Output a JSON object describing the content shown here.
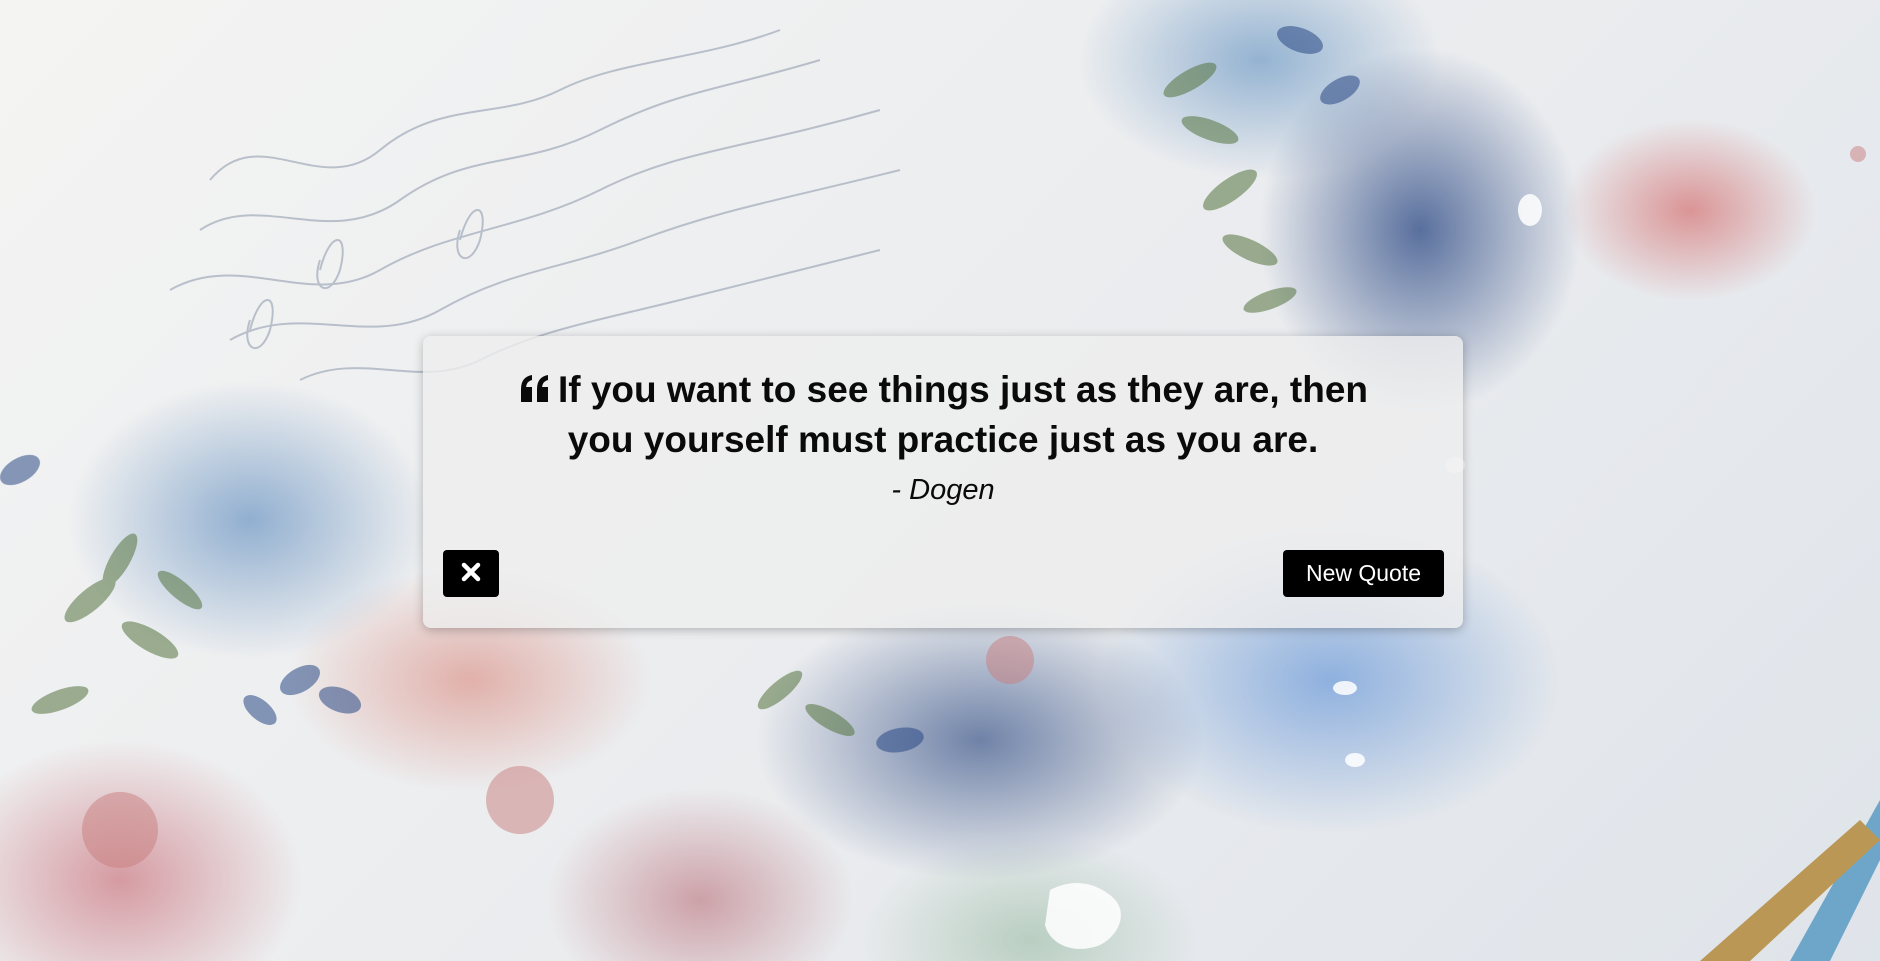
{
  "background": {
    "description_icon": "watercolor-floral-background"
  },
  "quote": {
    "icon": "quote-left-icon",
    "text": "If you want to see things just as they are, then you yourself must practice just as you are.",
    "author": "- Dogen"
  },
  "controls": {
    "close_icon": "close-icon",
    "new_quote_label": "New Quote"
  },
  "colors": {
    "button_bg": "#000000",
    "button_text": "#ffffff",
    "card_bg": "#eeeeee",
    "text": "#0a0a0a"
  }
}
